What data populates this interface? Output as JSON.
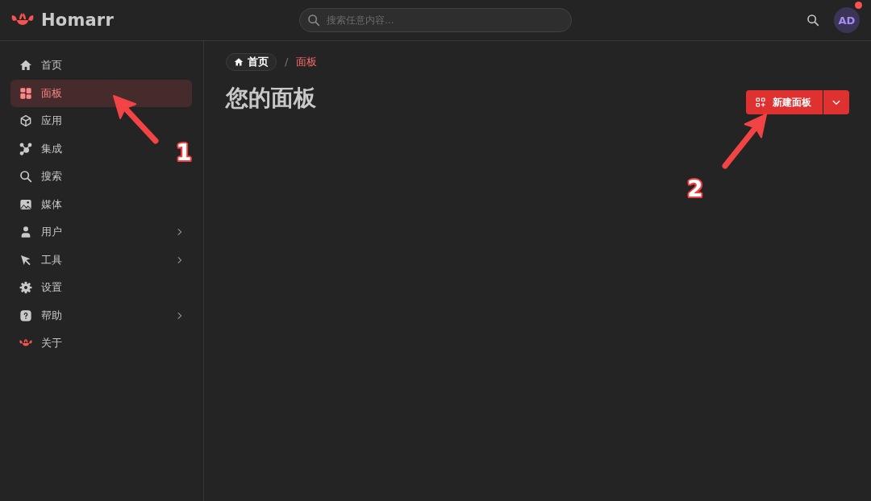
{
  "header": {
    "logo_text": "Homarr",
    "search": {
      "placeholder": "搜索任意内容..."
    },
    "avatar": {
      "initials": "AD",
      "notification": true
    }
  },
  "sidebar": {
    "items": [
      {
        "label": "首页",
        "selected": false,
        "expandable": false
      },
      {
        "label": "面板",
        "selected": true,
        "expandable": false
      },
      {
        "label": "应用",
        "selected": false,
        "expandable": false
      },
      {
        "label": "集成",
        "selected": false,
        "expandable": false
      },
      {
        "label": "搜索",
        "selected": false,
        "expandable": false
      },
      {
        "label": "媒体",
        "selected": false,
        "expandable": false
      },
      {
        "label": "用户",
        "selected": false,
        "expandable": true
      },
      {
        "label": "工具",
        "selected": false,
        "expandable": true
      },
      {
        "label": "设置",
        "selected": false,
        "expandable": false
      },
      {
        "label": "帮助",
        "selected": false,
        "expandable": true
      },
      {
        "label": "关于",
        "selected": false,
        "expandable": false
      }
    ]
  },
  "breadcrumb": {
    "separator": "/",
    "items": [
      {
        "label": "首页",
        "current": false
      },
      {
        "label": "面板",
        "current": true
      }
    ]
  },
  "page": {
    "title": "您的面板",
    "new_button": {
      "label": "新建面板"
    }
  },
  "annotations": [
    {
      "label": "1"
    },
    {
      "label": "2"
    }
  ]
}
